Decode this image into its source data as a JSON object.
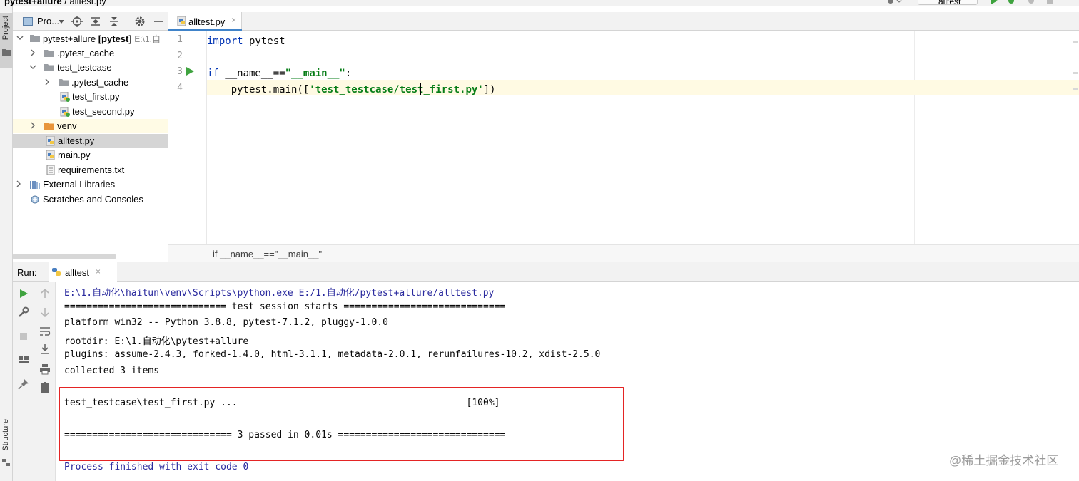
{
  "window": {
    "project_name": "pytest+allure",
    "separator": "/",
    "file_name": "alltest.py",
    "run_config": "alltest"
  },
  "tool_strip": {
    "project_label": "Project",
    "structure_label": "Structure"
  },
  "project_panel": {
    "title": "Pro...",
    "tree": [
      {
        "label": "pytest+allure",
        "bold_suffix": "[pytest]",
        "extra": "E:\\1.自",
        "icon": "folder-icon",
        "expanded": true
      },
      {
        "label": ".pytest_cache",
        "icon": "folder-icon",
        "expanded": false
      },
      {
        "label": "test_testcase",
        "icon": "folder-icon",
        "expanded": true
      },
      {
        "label": ".pytest_cache",
        "icon": "folder-icon",
        "expanded": false
      },
      {
        "label": "test_first.py",
        "icon": "python-test-file-icon"
      },
      {
        "label": "test_second.py",
        "icon": "python-test-file-icon"
      },
      {
        "label": "venv",
        "icon": "orange-folder-icon",
        "expanded": false
      },
      {
        "label": "alltest.py",
        "icon": "python-file-icon",
        "selected": true
      },
      {
        "label": "main.py",
        "icon": "python-file-icon"
      },
      {
        "label": "requirements.txt",
        "icon": "text-file-icon"
      },
      {
        "label": "External Libraries",
        "icon": "libraries-icon",
        "expanded": false
      },
      {
        "label": "Scratches and Consoles",
        "icon": "scratches-icon"
      }
    ]
  },
  "editor": {
    "tab_label": "alltest.py",
    "close_glyph": "×",
    "line_numbers": [
      "1",
      "2",
      "3",
      "4"
    ],
    "code": {
      "l1_kw": "import",
      "l1_rest": " pytest",
      "l3_kw": "if",
      "l3_rest": " __name__==",
      "l3_str": "\"__main__\"",
      "l3_end": ":",
      "l4_indent": "    pytest.main([",
      "l4_str": "'test_testcase/test_first.py'",
      "l4_end": "])"
    },
    "breadcrumb": "if __name__==\"__main__\""
  },
  "run_panel": {
    "label": "Run:",
    "tab_label": "alltest",
    "close_glyph": "×",
    "console_lines": [
      "E:\\1.自动化\\haitun\\venv\\Scripts\\python.exe E:/1.自动化/pytest+allure/alltest.py",
      "============================= test session starts =============================",
      "platform win32 -- Python 3.8.8, pytest-7.1.2, pluggy-1.0.0",
      "rootdir: E:\\1.自动化\\pytest+allure",
      "plugins: assume-2.4.3, forked-1.4.0, html-3.1.1, metadata-2.0.1, rerunfailures-10.2, xdist-2.5.0",
      "collected 3 items",
      "test_testcase\\test_first.py ...                                         [100%]",
      "============================== 3 passed in 0.01s ==============================",
      "Process finished with exit code 0"
    ]
  },
  "watermark": "@稀土掘金技术社区",
  "colors": {
    "keyword": "#0033b3",
    "string": "#067d17",
    "highlight_box": "#e42424",
    "run_green": "#3fa33f",
    "tab_underline": "#4083c9"
  }
}
